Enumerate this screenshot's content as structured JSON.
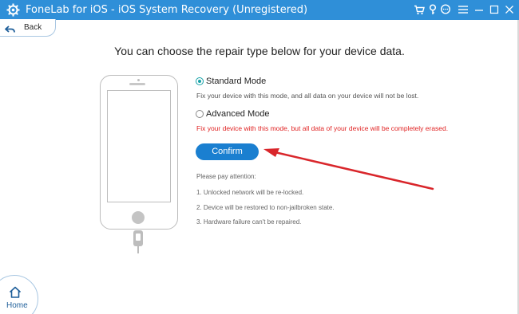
{
  "window": {
    "title": "FoneLab for iOS - iOS System Recovery (Unregistered)",
    "app_icon": "gear-icon",
    "controls": [
      "cart-icon",
      "key-icon",
      "chat-icon",
      "menu-icon",
      "minimize-icon",
      "maximize-icon",
      "close-icon"
    ],
    "accent": "#2f8fd8"
  },
  "nav": {
    "back_label": "Back",
    "home_label": "Home"
  },
  "main": {
    "heading": "You can choose the repair type below for your device data.",
    "options": [
      {
        "label": "Standard Mode",
        "description": "Fix your device with this mode, and all data on your device will not be lost.",
        "selected": true
      },
      {
        "label": "Advanced Mode",
        "description": "Fix your device with this mode, but all data of your device will be completely erased.",
        "selected": false,
        "description_color": "#e02222"
      }
    ],
    "confirm_label": "Confirm",
    "attention": {
      "title": "Please pay attention:",
      "items": [
        "1. Unlocked network will be re-locked.",
        "2. Device will be restored to non-jailbroken state.",
        "3. Hardware failure can't be repaired."
      ]
    }
  }
}
